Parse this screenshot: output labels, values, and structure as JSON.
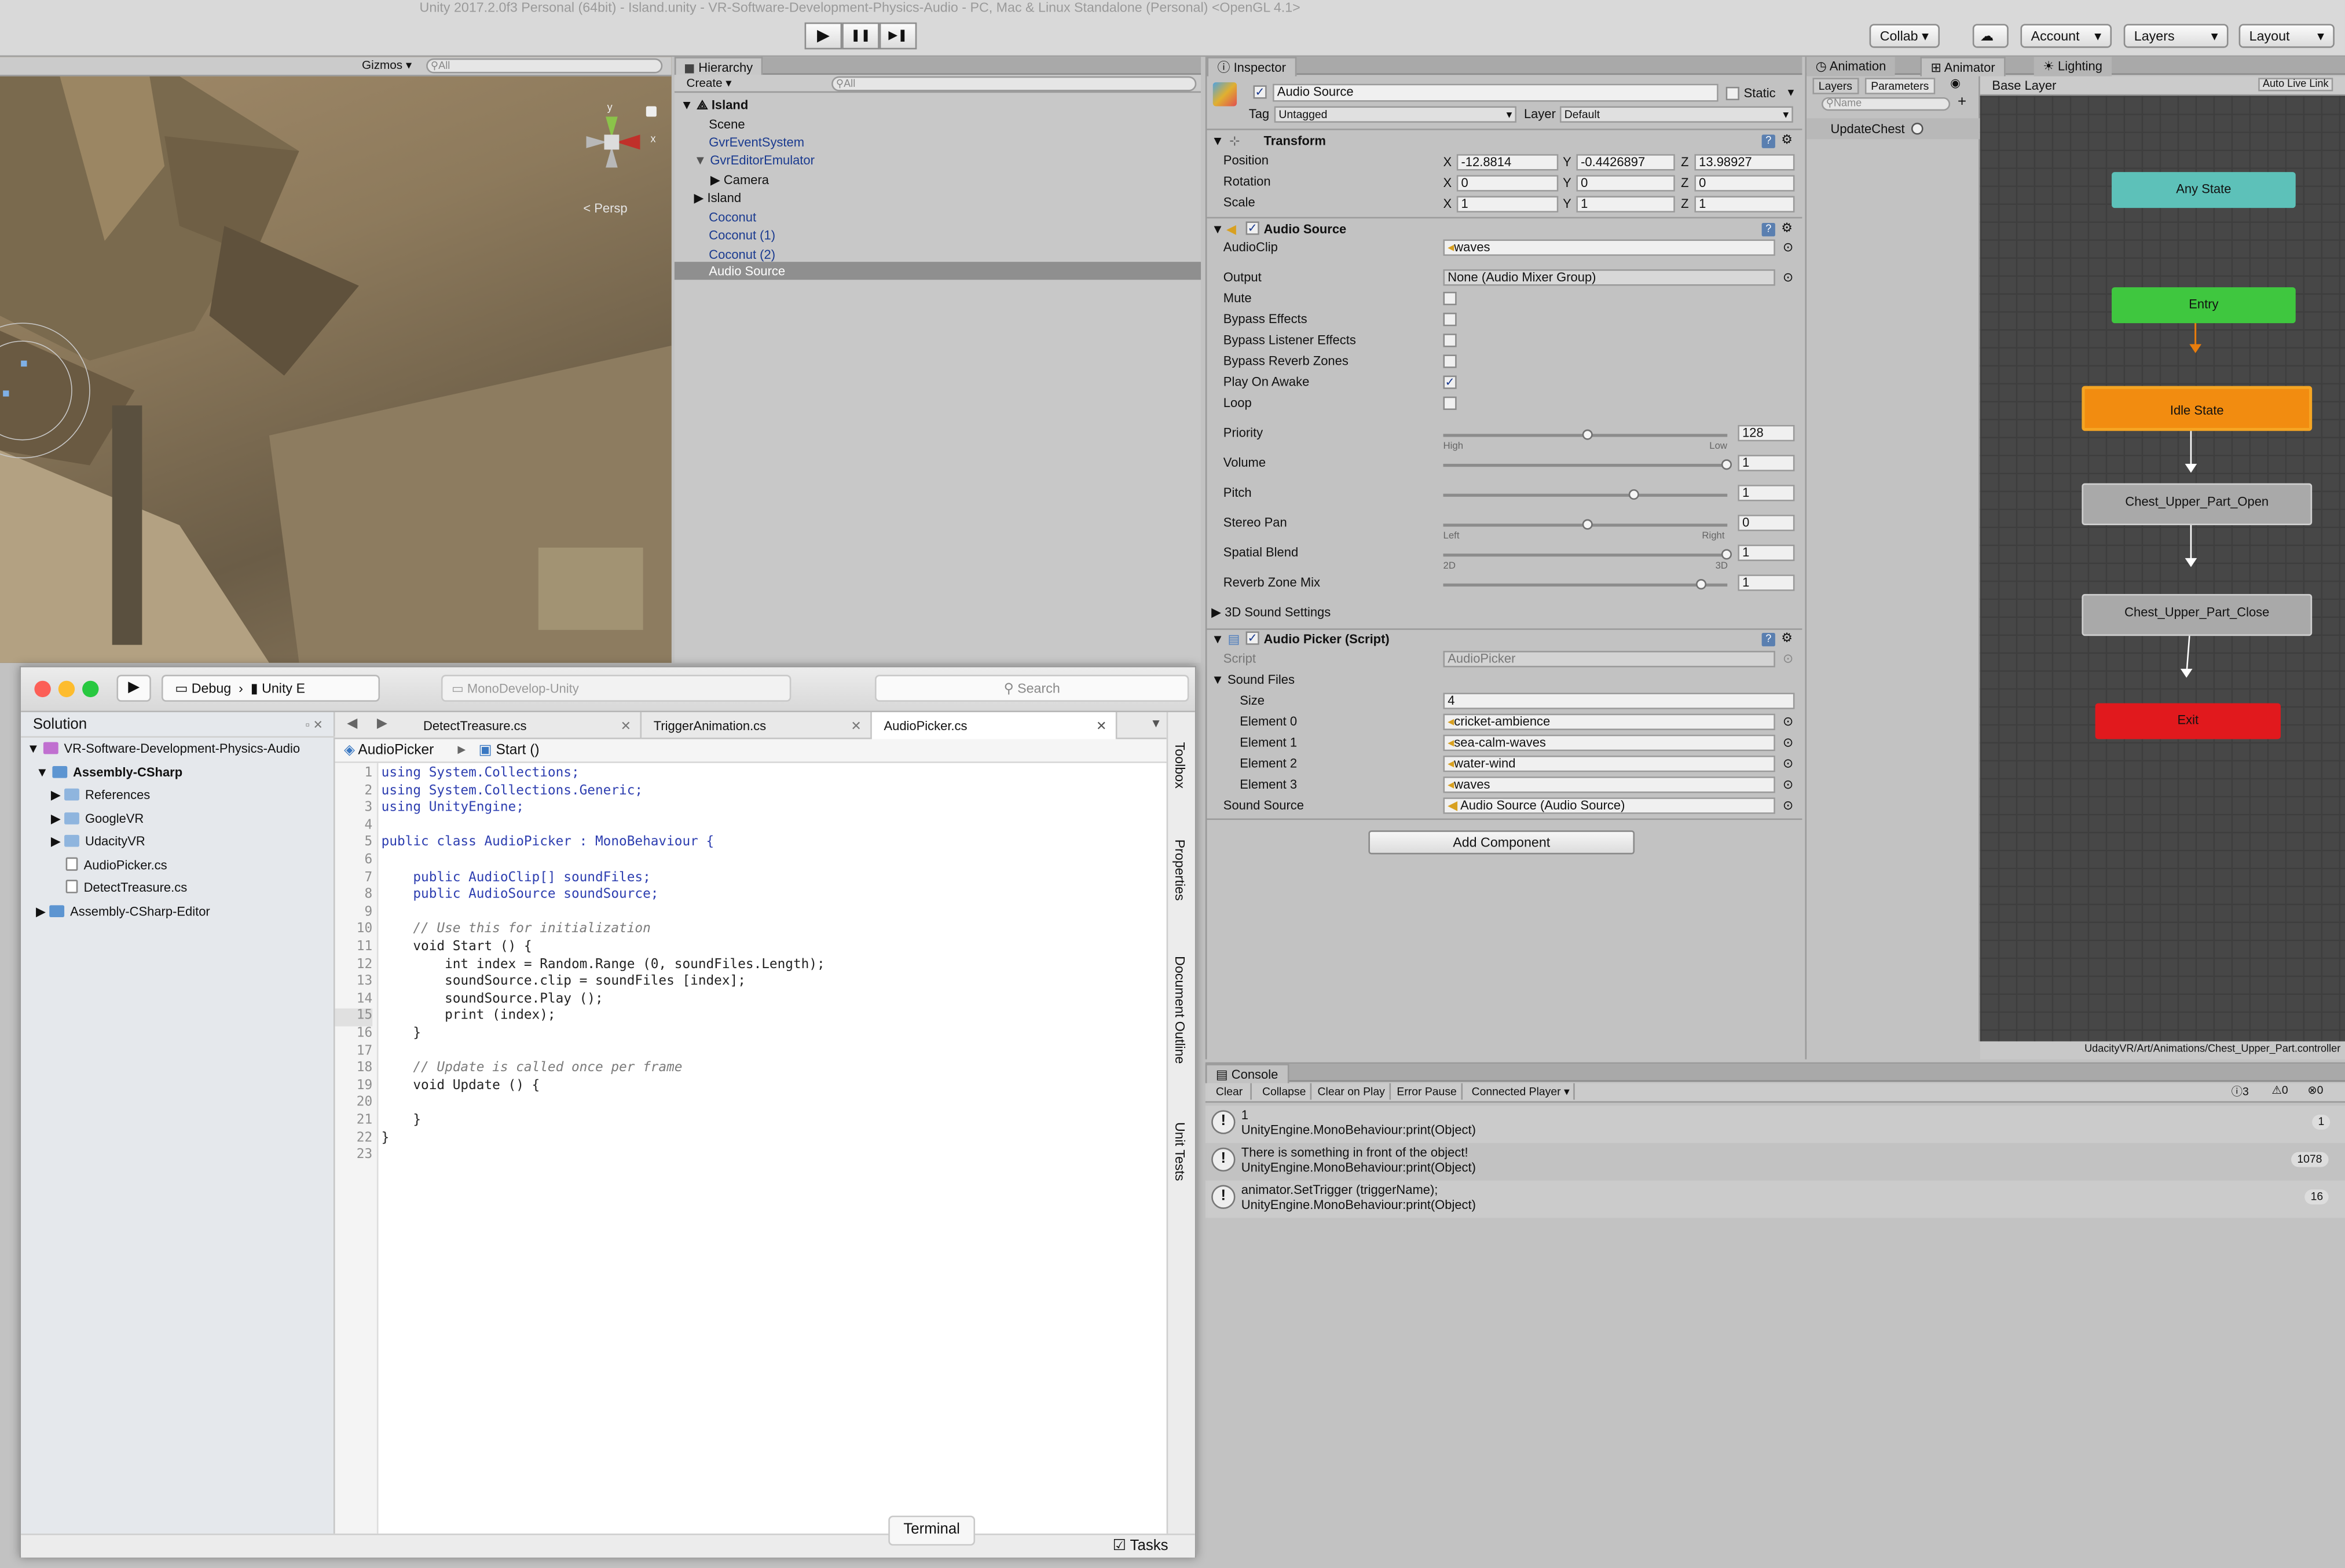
{
  "window_title": "Unity 2017.2.0f3 Personal (64bit) - Island.unity - VR-Software-Development-Physics-Audio - PC, Mac & Linux Standalone (Personal) <OpenGL 4.1>",
  "toolbar": {
    "play": "▶",
    "pause": "❚❚",
    "step": "▶❚",
    "collab": "Collab ▾",
    "account": "Account",
    "layers": "Layers",
    "layout": "Layout"
  },
  "scene": {
    "gizmos": "Gizmos ▾",
    "search_placeholder": "All",
    "persp": "Persp",
    "axis_x": "x",
    "axis_y": "y"
  },
  "hierarchy": {
    "tab": "Hierarchy",
    "create": "Create ▾",
    "search_placeholder": "All",
    "items": [
      {
        "label": "Island"
      },
      {
        "label": "Scene"
      },
      {
        "label": "GvrEventSystem"
      },
      {
        "label": "GvrEditorEmulator"
      },
      {
        "label": "Camera"
      },
      {
        "label": "Island"
      },
      {
        "label": "Coconut"
      },
      {
        "label": "Coconut (1)"
      },
      {
        "label": "Coconut (2)"
      },
      {
        "label": "Audio Source"
      }
    ]
  },
  "inspector": {
    "tab": "Inspector",
    "object_name": "Audio Source",
    "static": "Static",
    "tag_label": "Tag",
    "tag_value": "Untagged",
    "layer_label": "Layer",
    "layer_value": "Default",
    "transform": {
      "title": "Transform",
      "position_label": "Position",
      "rotation_label": "Rotation",
      "scale_label": "Scale",
      "px": "-12.8814",
      "py": "-0.4426897",
      "pz": "13.98927",
      "rx": "0",
      "ry": "0",
      "rz": "0",
      "sx": "1",
      "sy": "1",
      "sz": "1",
      "x": "X",
      "y": "Y",
      "z": "Z"
    },
    "audio_source": {
      "title": "Audio Source",
      "audioclip_label": "AudioClip",
      "audioclip_value": "waves",
      "output_label": "Output",
      "output_value": "None (Audio Mixer Group)",
      "mute": "Mute",
      "bypass_effects": "Bypass Effects",
      "bypass_listener": "Bypass Listener Effects",
      "bypass_reverb": "Bypass Reverb Zones",
      "play_on_awake": "Play On Awake",
      "loop": "Loop",
      "priority_label": "Priority",
      "priority_value": "128",
      "high": "High",
      "low": "Low",
      "volume_label": "Volume",
      "volume_value": "1",
      "pitch_label": "Pitch",
      "pitch_value": "1",
      "stereo_label": "Stereo Pan",
      "stereo_value": "0",
      "left": "Left",
      "right": "Right",
      "spatial_label": "Spatial Blend",
      "spatial_value": "1",
      "s2d": "2D",
      "s3d": "3D",
      "reverb_label": "Reverb Zone Mix",
      "reverb_value": "1",
      "sound3d": "3D Sound Settings"
    },
    "audio_picker": {
      "title": "Audio Picker (Script)",
      "script_label": "Script",
      "script_value": "AudioPicker",
      "sound_files_label": "Sound Files",
      "size_label": "Size",
      "size_value": "4",
      "elements": [
        {
          "label": "Element 0",
          "value": "cricket-ambience"
        },
        {
          "label": "Element 1",
          "value": "sea-calm-waves"
        },
        {
          "label": "Element 2",
          "value": "water-wind"
        },
        {
          "label": "Element 3",
          "value": "waves"
        }
      ],
      "sound_source_label": "Sound Source",
      "sound_source_value": "Audio Source (Audio Source)"
    },
    "add_component": "Add Component"
  },
  "animator": {
    "tabs": [
      "Animation",
      "Animator",
      "Lighting"
    ],
    "sub_tabs": [
      "Layers",
      "Parameters"
    ],
    "search_placeholder": "Name",
    "param": "UpdateChest",
    "base_layer": "Base Layer",
    "auto_live": "Auto Live Link",
    "states": {
      "any": "Any State",
      "entry": "Entry",
      "idle": "Idle State",
      "open": "Chest_Upper_Part_Open",
      "close": "Chest_Upper_Part_Close",
      "exit": "Exit"
    },
    "path": "UdacityVR/Art/Animations/Chest_Upper_Part.controller"
  },
  "console": {
    "tab": "Console",
    "buttons": [
      "Clear",
      "Collapse",
      "Clear on Play",
      "Error Pause",
      "Connected Player ▾"
    ],
    "counts": [
      "3",
      "0",
      "0"
    ],
    "rows": [
      {
        "line1": "1",
        "line2": "UnityEngine.MonoBehaviour:print(Object)",
        "count": "1"
      },
      {
        "line1": "There is something in front of the object!",
        "line2": "UnityEngine.MonoBehaviour:print(Object)",
        "count": "1078"
      },
      {
        "line1": "animator.SetTrigger (triggerName);",
        "line2": "UnityEngine.MonoBehaviour:print(Object)",
        "count": "16"
      }
    ]
  },
  "mono": {
    "config": "Debug",
    "target": "Unity E",
    "app_title": "MonoDevelop-Unity",
    "search": "Search",
    "solution_title": "Solution",
    "solution": [
      {
        "label": "VR-Software-Development-Physics-Audio"
      },
      {
        "label": "Assembly-CSharp"
      },
      {
        "label": "References"
      },
      {
        "label": "GoogleVR"
      },
      {
        "label": "UdacityVR"
      },
      {
        "label": "AudioPicker.cs"
      },
      {
        "label": "DetectTreasure.cs"
      },
      {
        "label": "Assembly-CSharp-Editor"
      }
    ],
    "tabs": [
      "DetectTreasure.cs",
      "TriggerAnimation.cs",
      "AudioPicker.cs"
    ],
    "crumb_class": "AudioPicker",
    "crumb_method": "Start ()",
    "side_tabs": [
      "Toolbox",
      "Properties",
      "Document Outline",
      "Unit Tests"
    ],
    "terminal": "Terminal",
    "tasks": "Tasks",
    "code_lines": [
      "using System.Collections;",
      "using System.Collections.Generic;",
      "using UnityEngine;",
      "",
      "public class AudioPicker : MonoBehaviour {",
      "",
      "    public AudioClip[] soundFiles;",
      "    public AudioSource soundSource;",
      "",
      "    // Use this for initialization",
      "    void Start () {",
      "        int index = Random.Range (0, soundFiles.Length);",
      "        soundSource.clip = soundFiles [index];",
      "        soundSource.Play ();",
      "        print (index);",
      "    }",
      "",
      "    // Update is called once per frame",
      "    void Update () {",
      "",
      "    }",
      "}",
      ""
    ]
  }
}
